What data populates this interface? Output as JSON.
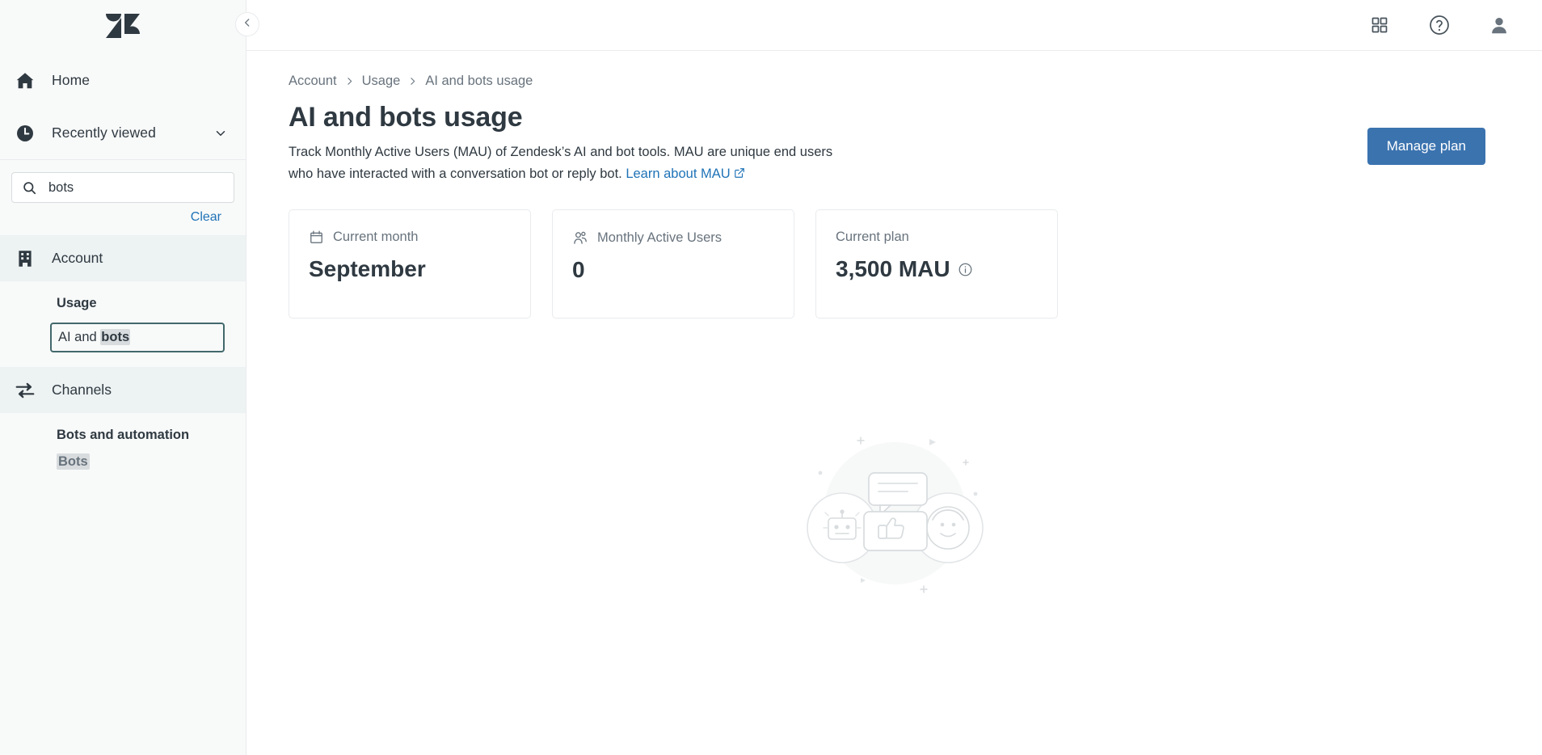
{
  "sidebar": {
    "logo_name": "zendesk-logo",
    "nav": [
      {
        "label": "Home",
        "icon": "home-icon"
      },
      {
        "label": "Recently viewed",
        "icon": "clock-icon",
        "trailing_icon": "chevron-down-icon"
      }
    ],
    "search": {
      "value": "bots",
      "placeholder": "Search",
      "icon": "search-icon"
    },
    "clear_label": "Clear",
    "sections": [
      {
        "label": "Account",
        "icon": "building-icon",
        "sub_title": "Usage",
        "sub_item_prefix": "AI and ",
        "sub_item_match": "bots"
      },
      {
        "label": "Channels",
        "icon": "transfer-arrows-icon",
        "sub_title": "Bots and automation",
        "sub_item_match": "Bots"
      }
    ],
    "collapse_icon": "chevron-left-icon"
  },
  "topbar": {
    "icons": [
      {
        "name": "apps-grid-icon"
      },
      {
        "name": "help-circle-icon"
      },
      {
        "name": "user-avatar-icon"
      }
    ]
  },
  "main": {
    "breadcrumb": [
      "Account",
      "Usage",
      "AI and bots usage"
    ],
    "title": "AI and bots usage",
    "description_part1": "Track Monthly Active Users (MAU) of Zendesk’s AI and bot tools. MAU are unique end users who have interacted with a conversation bot or reply bot. ",
    "link_label": "Learn about MAU",
    "link_icon": "external-link-icon",
    "manage_plan_label": "Manage plan",
    "cards": [
      {
        "label": "Current month",
        "icon": "calendar-icon",
        "value": "September",
        "info": false
      },
      {
        "label": "Monthly Active Users",
        "icon": "people-icon",
        "value": "0",
        "info": false
      },
      {
        "label": "Current plan",
        "icon": "",
        "value": "3,500 MAU",
        "info": true,
        "info_icon": "info-circle-icon"
      }
    ],
    "illustration_name": "bots-conversation-empty-state-illustration"
  },
  "colors": {
    "accent_blue": "#3b73af",
    "link_blue": "#1f73b7",
    "text_dark": "#2f3941",
    "text_muted": "#68737d",
    "border": "#e9ebed",
    "sidebar_bg": "#f8f9f9",
    "section_bg": "#edf2f2",
    "focus_teal": "#42686c",
    "highlight": "#d8dcde"
  }
}
